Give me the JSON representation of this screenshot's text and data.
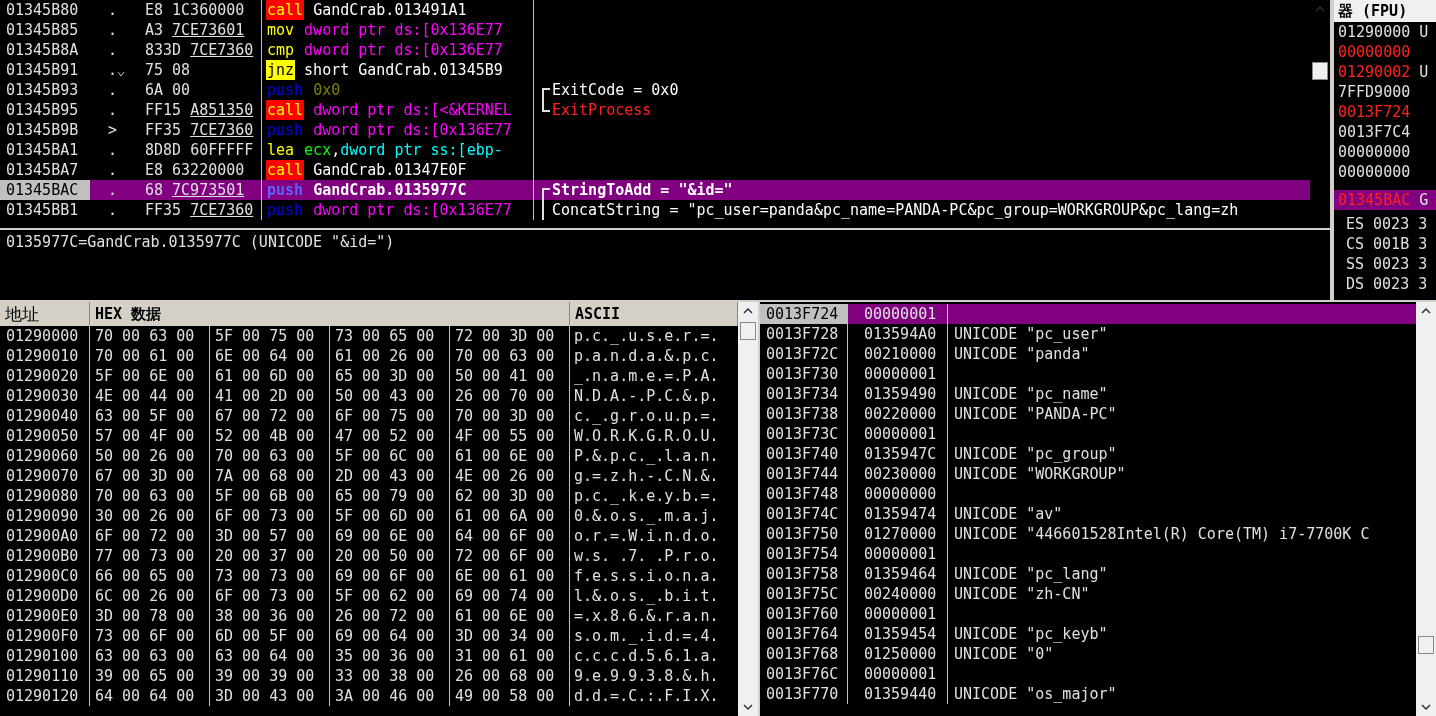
{
  "disassembly": {
    "rows": [
      {
        "address": "01345B80",
        "mark": ".",
        "opcode": "E8",
        "operand": "1C360000",
        "underlined": false,
        "mnemonic": "call",
        "kind": "call",
        "args": [
          {
            "text": "GandCrab.013491A1",
            "color": "#ffffff"
          }
        ],
        "selected": false
      },
      {
        "address": "01345B85",
        "mark": ".",
        "opcode": "A3",
        "operand": "7CE73601",
        "underlined": true,
        "mnemonic": "mov",
        "kind": "op",
        "args": [
          {
            "text": "dword ptr ds:[0x136E77",
            "color": "#ff00ff"
          }
        ],
        "selected": false
      },
      {
        "address": "01345B8A",
        "mark": ".",
        "opcode": "833D",
        "operand": "7CE7360",
        "underlined": true,
        "mnemonic": "cmp",
        "kind": "op",
        "args": [
          {
            "text": "dword ptr ds:[0x136E77",
            "color": "#ff00ff"
          }
        ],
        "selected": false
      },
      {
        "address": "01345B91",
        "mark": ".",
        "jump_down": true,
        "opcode": "75",
        "operand": "08",
        "underlined": false,
        "mnemonic": "jnz",
        "kind": "jump",
        "args": [
          {
            "text": "short GandCrab.01345B9",
            "color": "#ffffff"
          }
        ],
        "selected": false
      },
      {
        "address": "01345B93",
        "mark": ".",
        "opcode": "6A",
        "operand": "00",
        "underlined": false,
        "mnemonic": "push",
        "kind": "push",
        "args": [
          {
            "text": "0x0",
            "color": "#808000"
          }
        ],
        "comment": {
          "text": "ExitCode = 0x0",
          "color": "#ffffff",
          "opens_group": true,
          "closes_group": false
        },
        "selected": false
      },
      {
        "address": "01345B95",
        "mark": ".",
        "opcode": "FF15",
        "operand": "A851350",
        "underlined": true,
        "mnemonic": "call",
        "kind": "call",
        "args": [
          {
            "text": "dword ptr ds:[<&KERNEL",
            "color": "#ff00ff"
          }
        ],
        "comment": {
          "text": "ExitProcess",
          "color": "#ff2020",
          "opens_group": false,
          "closes_group": true
        },
        "selected": false
      },
      {
        "address": "01345B9B",
        "mark": ">",
        "opcode": "FF35",
        "operand": "7CE7360",
        "underlined": true,
        "mnemonic": "push",
        "kind": "push",
        "args": [
          {
            "text": "dword ptr ds:[0x136E77",
            "color": "#ff00ff"
          }
        ],
        "selected": false
      },
      {
        "address": "01345BA1",
        "mark": ".",
        "opcode": "8D8D",
        "operand": "60FFFFF",
        "underlined": false,
        "mnemonic": "lea",
        "kind": "op",
        "args": [
          {
            "text": "ecx",
            "color": "#00ff00"
          },
          {
            "text": ",",
            "color": "#ffffff"
          },
          {
            "text": "dword ptr ss:[ebp-",
            "color": "#00ffff"
          }
        ],
        "selected": false
      },
      {
        "address": "01345BA7",
        "mark": ".",
        "opcode": "E8",
        "operand": "63220000",
        "underlined": false,
        "mnemonic": "call",
        "kind": "call",
        "args": [
          {
            "text": "GandCrab.01347E0F",
            "color": "#ffffff"
          }
        ],
        "selected": false
      },
      {
        "address": "01345BAC",
        "mark": ".",
        "opcode": "68",
        "operand": "7C973501",
        "underlined": true,
        "mnemonic": "push",
        "kind": "push",
        "args": [
          {
            "text": "GandCrab.0135977C"
          }
        ],
        "comment": {
          "text": "StringToAdd = \"&id=\"",
          "opens_group": true,
          "closes_group": false
        },
        "selected": true
      },
      {
        "address": "01345BB1",
        "mark": ".",
        "opcode": "FF35",
        "operand": "7CE7360",
        "underlined": true,
        "mnemonic": "push",
        "kind": "push",
        "args": [
          {
            "text": "dword ptr ds:[0x136E77",
            "color": "#ff00ff"
          }
        ],
        "comment": {
          "text": "ConcatString = \"pc_user=panda&pc_name=PANDA-PC&pc_group=WORKGROUP&pc_lang=zh",
          "color": "#ffffff",
          "opens_group": false,
          "closes_group": false
        },
        "selected": false
      }
    ],
    "info": "0135977C=GandCrab.0135977C (UNICODE \"&id=\")"
  },
  "registers": {
    "title": "器 (FPU)",
    "rows": [
      {
        "value": "01290000",
        "suffix": "U",
        "changed": false
      },
      {
        "value": "00000000",
        "changed": true
      },
      {
        "value": "01290002",
        "suffix": "U",
        "changed": true
      },
      {
        "value": "7FFD9000",
        "changed": false
      },
      {
        "value": "0013F724",
        "changed": true
      },
      {
        "value": "0013F7C4",
        "changed": false
      },
      {
        "value": "00000000",
        "changed": false
      },
      {
        "value": "00000000",
        "changed": false
      }
    ],
    "eip": {
      "value": "01345BAC",
      "suffix": "G",
      "changed": true,
      "selected": true
    },
    "segments": [
      {
        "name": "ES",
        "value": "0023",
        "suffix": "3"
      },
      {
        "name": "CS",
        "value": "001B",
        "suffix": "3"
      },
      {
        "name": "SS",
        "value": "0023",
        "suffix": "3"
      },
      {
        "name": "DS",
        "value": "0023",
        "suffix": "3"
      }
    ]
  },
  "dump": {
    "columns": [
      "地址",
      "HEX 数据",
      "ASCII"
    ],
    "rows": [
      {
        "address": "01290000",
        "groups": [
          "70 00 63 00",
          "5F 00 75 00",
          "73 00 65 00",
          "72 00 3D 00"
        ],
        "ascii": "p.c._.u.s.e.r.=."
      },
      {
        "address": "01290010",
        "groups": [
          "70 00 61 00",
          "6E 00 64 00",
          "61 00 26 00",
          "70 00 63 00"
        ],
        "ascii": "p.a.n.d.a.&.p.c."
      },
      {
        "address": "01290020",
        "groups": [
          "5F 00 6E 00",
          "61 00 6D 00",
          "65 00 3D 00",
          "50 00 41 00"
        ],
        "ascii": "_.n.a.m.e.=.P.A."
      },
      {
        "address": "01290030",
        "groups": [
          "4E 00 44 00",
          "41 00 2D 00",
          "50 00 43 00",
          "26 00 70 00"
        ],
        "ascii": "N.D.A.-.P.C.&.p."
      },
      {
        "address": "01290040",
        "groups": [
          "63 00 5F 00",
          "67 00 72 00",
          "6F 00 75 00",
          "70 00 3D 00"
        ],
        "ascii": "c._.g.r.o.u.p.=."
      },
      {
        "address": "01290050",
        "groups": [
          "57 00 4F 00",
          "52 00 4B 00",
          "47 00 52 00",
          "4F 00 55 00"
        ],
        "ascii": "W.O.R.K.G.R.O.U."
      },
      {
        "address": "01290060",
        "groups": [
          "50 00 26 00",
          "70 00 63 00",
          "5F 00 6C 00",
          "61 00 6E 00"
        ],
        "ascii": "P.&.p.c._.l.a.n."
      },
      {
        "address": "01290070",
        "groups": [
          "67 00 3D 00",
          "7A 00 68 00",
          "2D 00 43 00",
          "4E 00 26 00"
        ],
        "ascii": "g.=.z.h.-.C.N.&."
      },
      {
        "address": "01290080",
        "groups": [
          "70 00 63 00",
          "5F 00 6B 00",
          "65 00 79 00",
          "62 00 3D 00"
        ],
        "ascii": "p.c._.k.e.y.b.=."
      },
      {
        "address": "01290090",
        "groups": [
          "30 00 26 00",
          "6F 00 73 00",
          "5F 00 6D 00",
          "61 00 6A 00"
        ],
        "ascii": "0.&.o.s._.m.a.j."
      },
      {
        "address": "012900A0",
        "groups": [
          "6F 00 72 00",
          "3D 00 57 00",
          "69 00 6E 00",
          "64 00 6F 00"
        ],
        "ascii": "o.r.=.W.i.n.d.o."
      },
      {
        "address": "012900B0",
        "groups": [
          "77 00 73 00",
          "20 00 37 00",
          "20 00 50 00",
          "72 00 6F 00"
        ],
        "ascii": "w.s. .7. .P.r.o."
      },
      {
        "address": "012900C0",
        "groups": [
          "66 00 65 00",
          "73 00 73 00",
          "69 00 6F 00",
          "6E 00 61 00"
        ],
        "ascii": "f.e.s.s.i.o.n.a."
      },
      {
        "address": "012900D0",
        "groups": [
          "6C 00 26 00",
          "6F 00 73 00",
          "5F 00 62 00",
          "69 00 74 00"
        ],
        "ascii": "l.&.o.s._.b.i.t."
      },
      {
        "address": "012900E0",
        "groups": [
          "3D 00 78 00",
          "38 00 36 00",
          "26 00 72 00",
          "61 00 6E 00"
        ],
        "ascii": "=.x.8.6.&.r.a.n."
      },
      {
        "address": "012900F0",
        "groups": [
          "73 00 6F 00",
          "6D 00 5F 00",
          "69 00 64 00",
          "3D 00 34 00"
        ],
        "ascii": "s.o.m._.i.d.=.4."
      },
      {
        "address": "01290100",
        "groups": [
          "63 00 63 00",
          "63 00 64 00",
          "35 00 36 00",
          "31 00 61 00"
        ],
        "ascii": "c.c.c.d.5.6.1.a."
      },
      {
        "address": "01290110",
        "groups": [
          "39 00 65 00",
          "39 00 39 00",
          "33 00 38 00",
          "26 00 68 00"
        ],
        "ascii": "9.e.9.9.3.8.&.h."
      },
      {
        "address": "01290120",
        "groups": [
          "64 00 64 00",
          "3D 00 43 00",
          "3A 00 46 00",
          "49 00 58 00"
        ],
        "ascii": "d.d.=.C.:.F.I.X."
      }
    ]
  },
  "stack": {
    "rows": [
      {
        "address": "0013F724",
        "value": "00000001",
        "selected": true
      },
      {
        "address": "0013F728",
        "value": "013594A0",
        "comment": "UNICODE \"pc_user\"",
        "selected": false
      },
      {
        "address": "0013F72C",
        "value": "00210000",
        "comment": "UNICODE \"panda\"",
        "selected": false
      },
      {
        "address": "0013F730",
        "value": "00000001",
        "selected": false
      },
      {
        "address": "0013F734",
        "value": "01359490",
        "comment": "UNICODE \"pc_name\"",
        "selected": false
      },
      {
        "address": "0013F738",
        "value": "00220000",
        "comment": "UNICODE \"PANDA-PC\"",
        "selected": false
      },
      {
        "address": "0013F73C",
        "value": "00000001",
        "selected": false
      },
      {
        "address": "0013F740",
        "value": "0135947C",
        "comment": "UNICODE \"pc_group\"",
        "selected": false
      },
      {
        "address": "0013F744",
        "value": "00230000",
        "comment": "UNICODE \"WORKGROUP\"",
        "selected": false
      },
      {
        "address": "0013F748",
        "value": "00000000",
        "selected": false
      },
      {
        "address": "0013F74C",
        "value": "01359474",
        "comment": "UNICODE \"av\"",
        "selected": false
      },
      {
        "address": "0013F750",
        "value": "01270000",
        "comment": "UNICODE \"446601528Intel(R) Core(TM) i7-7700K C",
        "selected": false
      },
      {
        "address": "0013F754",
        "value": "00000001",
        "selected": false
      },
      {
        "address": "0013F758",
        "value": "01359464",
        "comment": "UNICODE \"pc_lang\"",
        "selected": false
      },
      {
        "address": "0013F75C",
        "value": "00240000",
        "comment": "UNICODE \"zh-CN\"",
        "selected": false
      },
      {
        "address": "0013F760",
        "value": "00000001",
        "selected": false
      },
      {
        "address": "0013F764",
        "value": "01359454",
        "comment": "UNICODE \"pc_keyb\"",
        "selected": false
      },
      {
        "address": "0013F768",
        "value": "01250000",
        "comment": "UNICODE \"0\"",
        "selected": false
      },
      {
        "address": "0013F76C",
        "value": "00000001",
        "selected": false
      },
      {
        "address": "0013F770",
        "value": "01359440",
        "comment": "UNICODE \"os_major\"",
        "selected": false
      }
    ]
  }
}
